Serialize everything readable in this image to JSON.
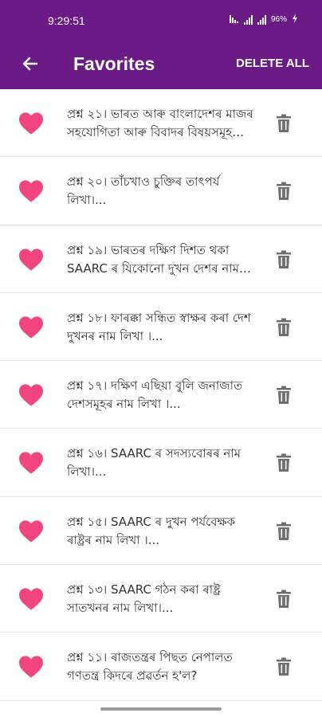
{
  "status_bar": {
    "time": "9:29:51",
    "battery": "96%",
    "icons": [
      "network-icon",
      "signal-icon",
      "signal-icon",
      "battery-charging-icon"
    ]
  },
  "app_bar": {
    "back_icon": "arrow-left-icon",
    "title": "Favorites",
    "delete_all_label": "DELETE ALL"
  },
  "favorites": [
    {
      "text": "প্রশ্ন ২১। ভাৰত আৰু বাংলাদেশৰ মাজৰ সহযোগিতা আৰু বিবাদৰ বিষয়সমূহ আলোচনা কৰা।"
    },
    {
      "text": "প্রশ্ন ২০। তাঁচখাও চুক্তিৰ তাৎপৰ্য লিখা।..."
    },
    {
      "text": "প্রশ্ন ১৯। ভাৰতৰ দক্ষিণ দিশত থকা SAARC ৰ যিকোনো দুখন দেশৰ নাম লিখা।"
    },
    {
      "text": "প্রশ্ন ১৮। ফাৰক্কা সন্ধিত স্বাক্ষৰ কৰা দেশ দুখনৰ নাম লিখা ।..."
    },
    {
      "text": "প্রশ্ন ১৭। দক্ষিণ এছিয়া বুলি জনাজাত দেশসমূহৰ নাম লিখা ।..."
    },
    {
      "text": "প্রশ্ন ১৬। SAARC ৰ সদস্যবোৰৰ নাম লিখা।..."
    },
    {
      "text": "প্রশ্ন ১৫। SAARC ৰ দুখন পৰ্যবেক্ষক ৰাষ্ট্ৰৰ নাম লিখা ।..."
    },
    {
      "text": "প্রশ্ন ১৩। SAARC গঠন কৰা ৰাষ্ট্ৰ সাতখনৰ নাম লিখা।..."
    },
    {
      "text": "প্রশ্ন ১১। ৰাজতন্ত্ৰৰ পিছত নেপালত গণতন্ত্ৰ কিদৰে প্ৰৱৰ্তন হ'ল?"
    }
  ],
  "row_icons": {
    "favorite": "heart-icon",
    "delete": "trash-icon"
  },
  "colors": {
    "app_bar": "#6a1b86",
    "heart": "#f0457f",
    "trash": "#6e6e6e",
    "text": "#333333",
    "divider": "#e2e2e2"
  }
}
